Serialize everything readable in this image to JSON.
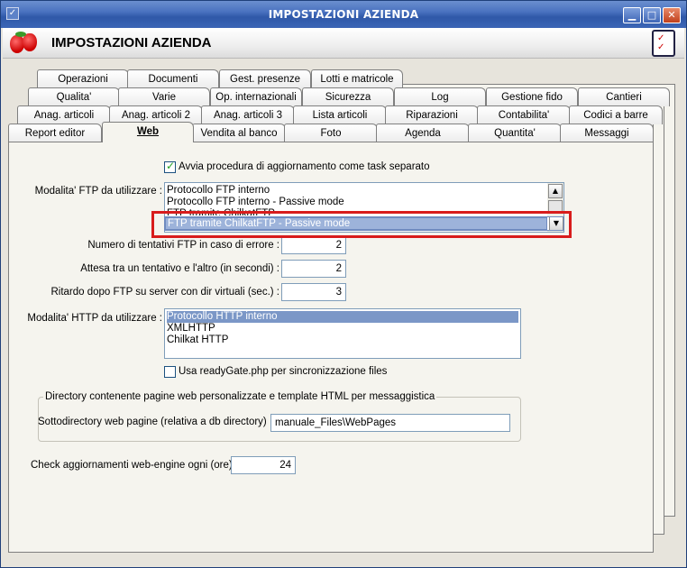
{
  "window": {
    "title": "IMPOSTAZIONI AZIENDA",
    "header_title": "IMPOSTAZIONI AZIENDA",
    "controls": {
      "minimize": "▁",
      "maximize": "□",
      "close": "✕"
    }
  },
  "tabs": {
    "row1": [
      "Operazioni",
      "Documenti",
      "Gest. presenze",
      "Lotti e matricole"
    ],
    "row2": [
      "Qualita'",
      "Varie",
      "Op. internazionali",
      "Sicurezza",
      "Log",
      "Gestione fido",
      "Cantieri"
    ],
    "row3": [
      "Anag. articoli",
      "Anag. articoli 2",
      "Anag. articoli 3",
      "Lista articoli",
      "Riparazioni",
      "Contabilita'",
      "Codici a barre"
    ],
    "row4": [
      "Report editor",
      "Web",
      "Vendita al banco",
      "Foto",
      "Agenda",
      "Quantita'",
      "Messaggi"
    ],
    "active": "Web"
  },
  "web": {
    "task_checkbox": {
      "label": "Avvia procedura di aggiornamento come task separato",
      "checked": true
    },
    "ftp_mode": {
      "label": "Modalita' FTP da utilizzare :",
      "options": [
        "Protocollo FTP interno",
        "Protocollo FTP interno - Passive mode",
        "FTP tramite ChilkatFTP",
        "FTP tramite ChilkatFTP - Passive mode"
      ],
      "selected": "FTP tramite ChilkatFTP - Passive mode"
    },
    "retries": {
      "label": "Numero di tentativi FTP in caso di errore :",
      "value": "2"
    },
    "wait": {
      "label": "Attesa tra un tentativo e l'altro (in secondi) :",
      "value": "2"
    },
    "delay": {
      "label": "Ritardo dopo FTP su server con dir virtuali (sec.) :",
      "value": "3"
    },
    "http_mode": {
      "label": "Modalita' HTTP da utilizzare :",
      "options": [
        "Protocollo HTTP interno",
        "XMLHTTP",
        "Chilkat HTTP"
      ],
      "selected": "Protocollo HTTP interno"
    },
    "readygate_checkbox": {
      "label": "Usa readyGate.php per sincronizzazione files",
      "checked": false
    },
    "directory_group": {
      "title": "Directory contenente pagine web personalizzate e template HTML per messaggistica",
      "subdir_label": "Sottodirectory web pagine (relativa a db directory) :",
      "subdir_value": "manuale_Files\\WebPages"
    },
    "check_updates": {
      "label": "Check aggiornamenti web-engine ogni (ore) :",
      "value": "24"
    }
  },
  "colors": {
    "highlight": "#d81c1c",
    "selection": "#7b97c7",
    "titlebar": "#3c66b6"
  }
}
